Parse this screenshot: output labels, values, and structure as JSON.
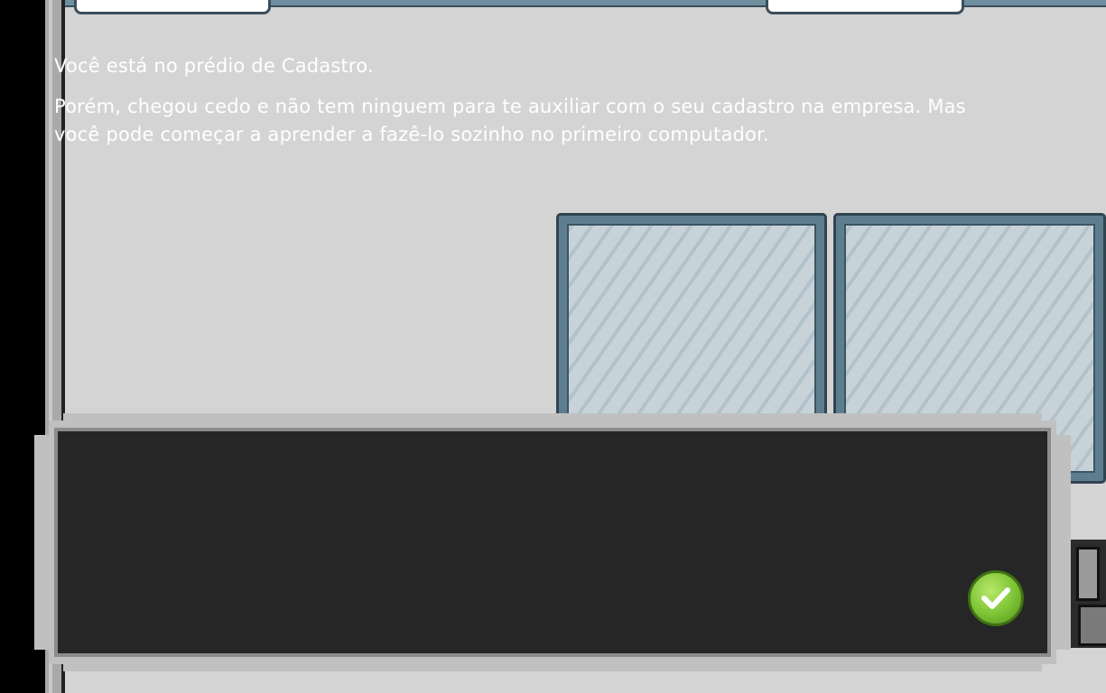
{
  "dialog": {
    "line1": "Você está no prédio de Cadastro.",
    "line2": "Porém, chegou cedo e não tem ninguem para te auxiliar com o seu cadastro na empresa. Mas você pode começar a aprender a fazê-lo sozinho no primeiro computador.",
    "confirm_icon": "check-icon"
  },
  "colors": {
    "wall": "#d4d4d4",
    "dialog_background": "#262626",
    "dialog_border": "#c0c0c0",
    "window_frame": "#5e7e8f",
    "confirm_button": "#7cc334"
  }
}
